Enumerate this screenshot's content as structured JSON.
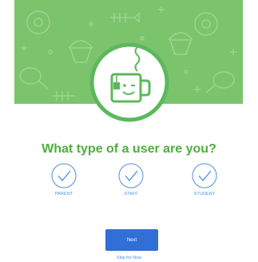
{
  "colors": {
    "banner": "#7cc46b",
    "pattern": "#a8d99a",
    "accent": "#5cb85c",
    "title": "#4caf3c",
    "ring": "#4a90e2",
    "label": "#4a90e2",
    "button": "#2f6fd6",
    "button_text": "#ffffff"
  },
  "banner": {
    "illustration_icon": "coffee-mug-mascot-icon",
    "pattern_icons": [
      "donut-icon",
      "cupcake-icon",
      "drumstick-icon",
      "fish-bone-icon",
      "cross-icon"
    ]
  },
  "question": {
    "title": "What type of a user are you?"
  },
  "roles": [
    {
      "label": "PARENT",
      "icon": "check-circle-icon"
    },
    {
      "label": "STAFF",
      "icon": "check-circle-icon"
    },
    {
      "label": "STUDENT",
      "icon": "check-circle-icon"
    }
  ],
  "actions": {
    "next_label": "Next",
    "skip_label": "Skip for Now"
  }
}
